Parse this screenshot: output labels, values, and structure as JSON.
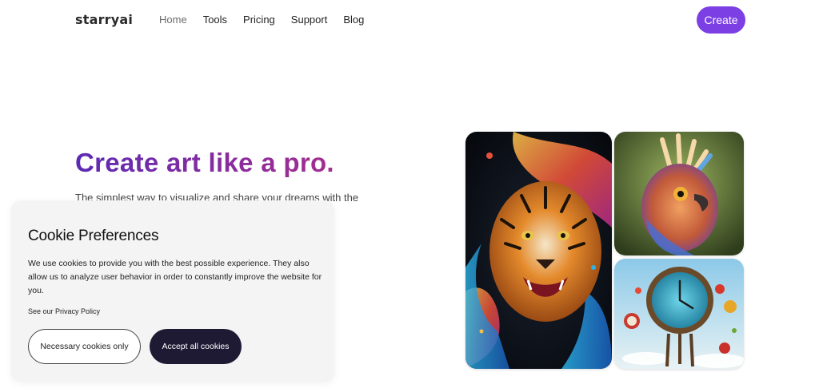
{
  "header": {
    "logo": "starryai",
    "nav": [
      {
        "label": "Home"
      },
      {
        "label": "Tools"
      },
      {
        "label": "Pricing"
      },
      {
        "label": "Support"
      },
      {
        "label": "Blog"
      }
    ],
    "cta_label": "Create"
  },
  "hero": {
    "title": "Create art like a pro.",
    "subtitle": "The simplest way to visualize and share your dreams with the world. Generate image and video"
  },
  "gallery": [
    {
      "icon": "tiger-art-image"
    },
    {
      "icon": "bird-art-image"
    },
    {
      "icon": "clock-art-image"
    }
  ],
  "cookie": {
    "title": "Cookie Preferences",
    "body": "We use cookies to provide you with the best possible experience. They also allow us to analyze user behavior in order to constantly improve the website for you.",
    "policy_link": "See our Privacy Policy",
    "necessary_label": "Necessary cookies only",
    "accept_label": "Accept all cookies"
  },
  "colors": {
    "accent": "#7b3fe4",
    "title_gradient_start": "#5b2bb3",
    "title_gradient_end": "#a22e8f",
    "dark_button": "#1e1a33"
  }
}
